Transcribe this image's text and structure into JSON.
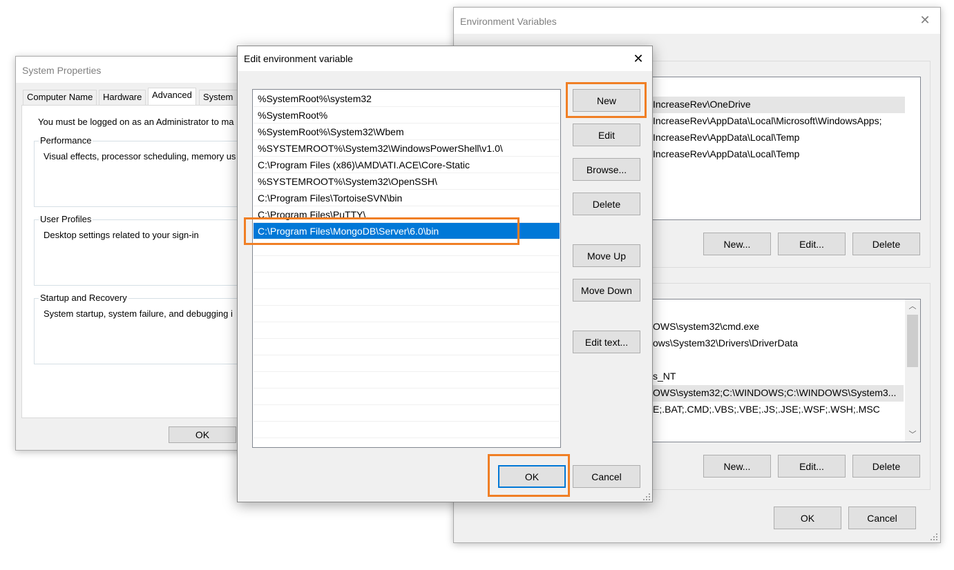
{
  "system_properties": {
    "title": "System Properties",
    "tabs": [
      "Computer Name",
      "Hardware",
      "Advanced",
      "System P"
    ],
    "admin_note": "You must be logged on as an Administrator to ma",
    "performance": {
      "legend": "Performance",
      "desc": "Visual effects, processor scheduling, memory us"
    },
    "user_profiles": {
      "legend": "User Profiles",
      "desc": "Desktop settings related to your sign-in"
    },
    "startup_recovery": {
      "legend": "Startup and Recovery",
      "desc": "System startup, system failure, and debugging i"
    },
    "ok_label": "OK"
  },
  "env_vars": {
    "title": "Environment Variables",
    "user_rows": [
      "IncreaseRev\\OneDrive",
      "IncreaseRev\\AppData\\Local\\Microsoft\\WindowsApps;",
      "IncreaseRev\\AppData\\Local\\Temp",
      "IncreaseRev\\AppData\\Local\\Temp"
    ],
    "system_rows": [
      "OWS\\system32\\cmd.exe",
      "ows\\System32\\Drivers\\DriverData",
      "s_NT",
      "OWS\\system32;C:\\WINDOWS;C:\\WINDOWS\\System3...",
      "E;.BAT;.CMD;.VBS;.VBE;.JS;.JSE;.WSF;.WSH;.MSC"
    ],
    "new_label": "New...",
    "edit_label": "Edit...",
    "delete_label": "Delete",
    "ok_label": "OK",
    "cancel_label": "Cancel"
  },
  "edit_dialog": {
    "title": "Edit environment variable",
    "paths": [
      "%SystemRoot%\\system32",
      "%SystemRoot%",
      "%SystemRoot%\\System32\\Wbem",
      "%SYSTEMROOT%\\System32\\WindowsPowerShell\\v1.0\\",
      "C:\\Program Files (x86)\\AMD\\ATI.ACE\\Core-Static",
      "%SYSTEMROOT%\\System32\\OpenSSH\\",
      "C:\\Program Files\\TortoiseSVN\\bin",
      "C:\\Program Files\\PuTTY\\",
      "C:\\Program Files\\MongoDB\\Server\\6.0\\bin"
    ],
    "buttons": {
      "new": "New",
      "edit": "Edit",
      "browse": "Browse...",
      "delete": "Delete",
      "move_up": "Move Up",
      "move_down": "Move Down",
      "edit_text": "Edit text...",
      "ok": "OK",
      "cancel": "Cancel"
    }
  },
  "colors": {
    "highlight": "#f07f25",
    "selection": "#0078d7"
  }
}
